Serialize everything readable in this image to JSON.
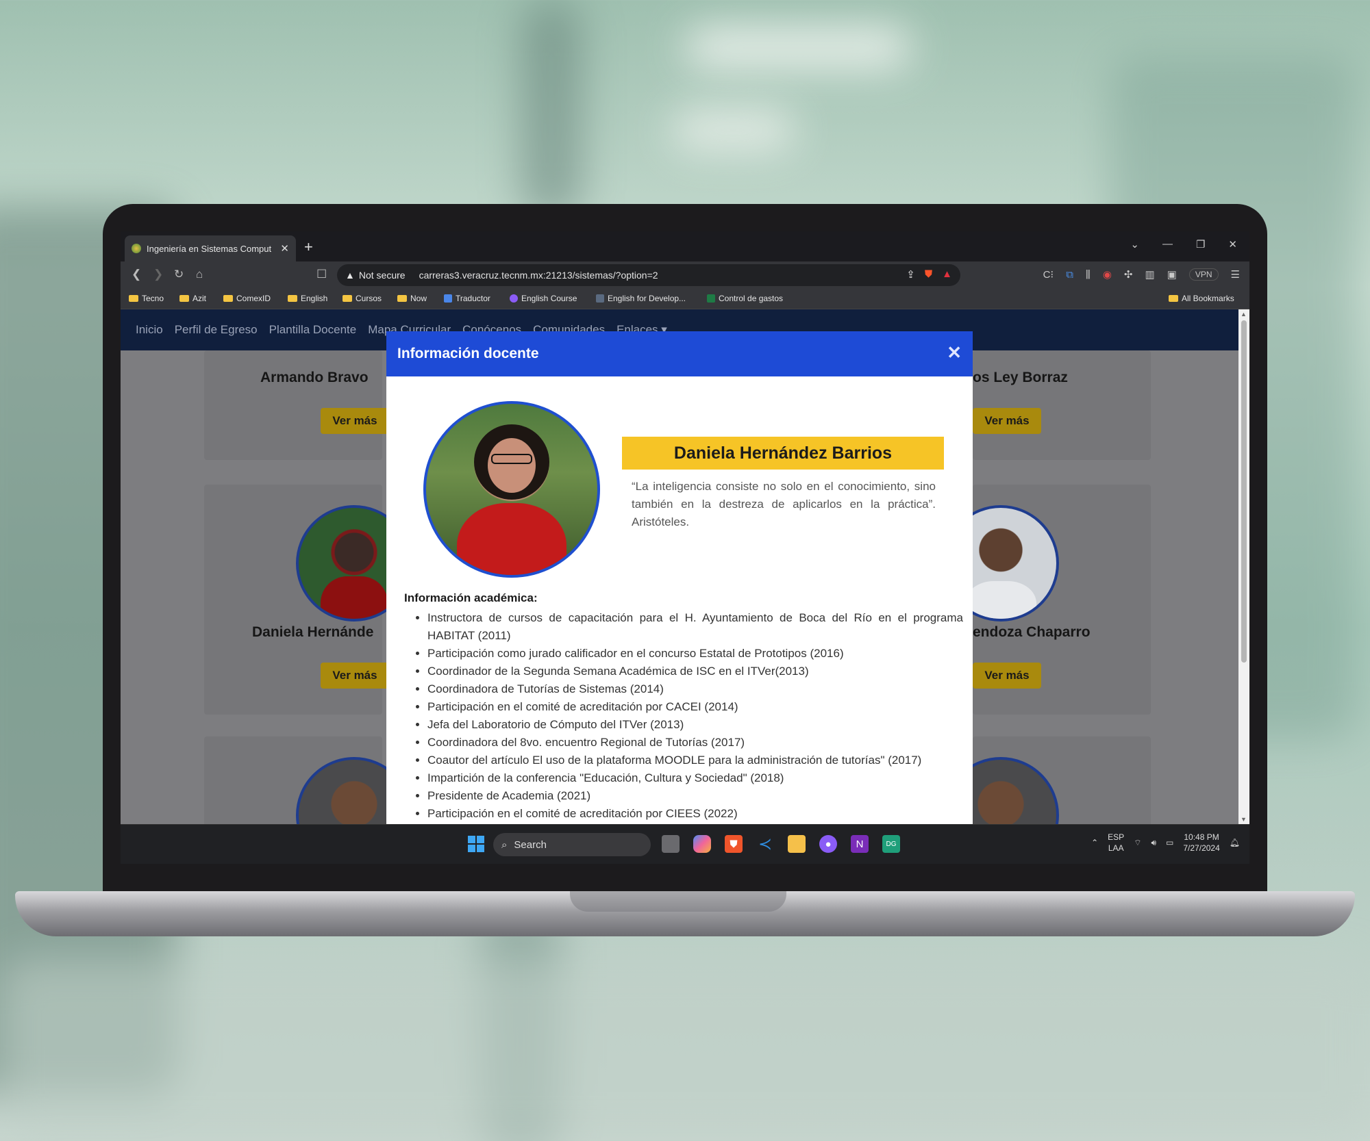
{
  "browser": {
    "tab_title": "Ingeniería en Sistemas Comput",
    "tab_close": "✕",
    "new_tab": "+",
    "address": {
      "security_label": "Not secure",
      "url": "carreras3.veracruz.tecnm.mx:21213/sistemas/?option=2"
    },
    "window_controls": [
      "⌄",
      "—",
      "❐",
      "✕"
    ],
    "vpn_label": "VPN",
    "bookmarks": [
      {
        "label": "Tecno",
        "icon": "folder-icon"
      },
      {
        "label": "Azit",
        "icon": "folder-icon"
      },
      {
        "label": "ComexID",
        "icon": "folder-icon"
      },
      {
        "label": "English",
        "icon": "folder-icon"
      },
      {
        "label": "Cursos",
        "icon": "folder-icon"
      },
      {
        "label": "Now",
        "icon": "folder-icon"
      },
      {
        "label": "Traductor",
        "icon": "translate-icon"
      },
      {
        "label": "English Course",
        "icon": "course-icon"
      },
      {
        "label": "English for Develop...",
        "icon": "doc-icon"
      },
      {
        "label": "Control de gastos",
        "icon": "excel-icon"
      }
    ],
    "all_bookmarks": "All Bookmarks"
  },
  "site": {
    "nav": [
      "Inicio",
      "Perfil de Egreso",
      "Plantilla Docente",
      "Mapa Curricular",
      "Conócenos",
      "Comunidades",
      "Enlaces ▾"
    ],
    "cards": [
      {
        "name": "Armando Bravo"
      },
      {
        "name": "os Ley Borraz"
      },
      {
        "name": "Daniela Hernánde"
      },
      {
        "name": "endoza Chaparro"
      }
    ],
    "ver_mas": "Ver más"
  },
  "modal": {
    "title": "Información docente",
    "close": "✕",
    "name": "Daniela Hernández Barrios",
    "quote": "“La inteligencia consiste no solo en el conocimiento, sino también en la destreza de aplicarlos en la práctica”. Aristóteles.",
    "academic_heading": "Información académica:",
    "academic_items": [
      "Instructora de cursos de capacitación para el H. Ayuntamiento de Boca del Río en el programa HABITAT (2011)",
      "Participación como jurado calificador en el concurso Estatal de Prototipos (2016)",
      "Coordinador de la Segunda Semana Académica de ISC en el ITVer(2013)",
      "Coordinadora de Tutorías de Sistemas (2014)",
      "Participación en el comité de acreditación por CACEI (2014)",
      "Jefa del Laboratorio de Cómputo del ITVer (2013)",
      "Coordinadora del 8vo. encuentro Regional de Tutorías (2017)",
      "Coautor del artículo El uso de la plataforma MOODLE para la administración de tutorías\" (2017)",
      "Impartición de la conferencia \"Educación, Cultura y Sociedad\" (2018)",
      "Presidente de Academia (2021)",
      "Participación en el comité de acreditación por CIEES (2022)"
    ]
  },
  "taskbar": {
    "search_placeholder": "Search",
    "lang_top": "ESP",
    "lang_bottom": "LAA",
    "time": "10:48 PM",
    "date": "7/27/2024"
  },
  "colors": {
    "modal_header": "#1e4bd6",
    "name_banner": "#f6c426",
    "site_nav": "#101f3d"
  }
}
